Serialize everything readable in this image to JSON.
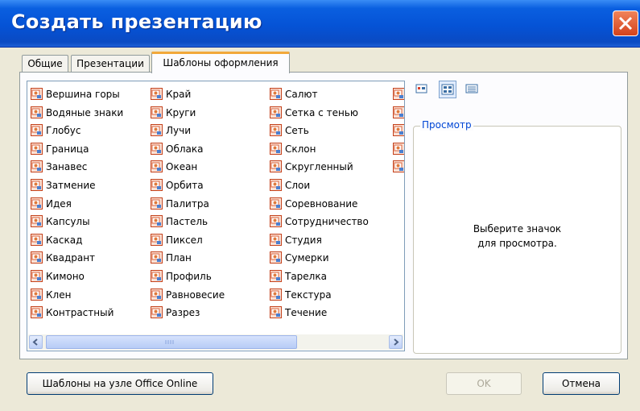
{
  "window": {
    "title": "Создать презентацию"
  },
  "tabs": [
    {
      "label": "Общие",
      "active": false
    },
    {
      "label": "Презентации",
      "active": false
    },
    {
      "label": "Шаблоны оформления",
      "active": true
    }
  ],
  "templates": {
    "column1": [
      "Вершина горы",
      "Водяные знаки",
      "Глобус",
      "Граница",
      "Занавес",
      "Затмение",
      "Идея",
      "Капсулы",
      "Каскад",
      "Квадрант",
      "Кимоно",
      "Клен",
      "Контрастный"
    ],
    "column2": [
      "Край",
      "Круги",
      "Лучи",
      "Облака",
      "Океан",
      "Орбита",
      "Палитра",
      "Пастель",
      "Пиксел",
      "План",
      "Профиль",
      "Равновесие",
      "Разрез"
    ],
    "column3": [
      "Салют",
      "Сетка с тенью",
      "Сеть",
      "Склон",
      "Скругленный",
      "Слои",
      "Соревнование",
      "Сотрудничество",
      "Студия",
      "Сумерки",
      "Тарелка",
      "Текстура",
      "Течение"
    ]
  },
  "view_buttons": [
    "large-icons-view-icon",
    "list-view-icon",
    "details-view-icon"
  ],
  "preview": {
    "legend": "Просмотр",
    "message": "Выберите значок\nдля просмотра."
  },
  "buttons": {
    "office_online": "Шаблоны на узле Office Online",
    "ok": "OK",
    "cancel": "Отмена"
  },
  "colors": {
    "titlebar": "#0553d6",
    "dialog_bg": "#ece9d8",
    "close": "#d4421c",
    "active_tab_accent": "#f2a83a",
    "legend": "#0046d5"
  }
}
